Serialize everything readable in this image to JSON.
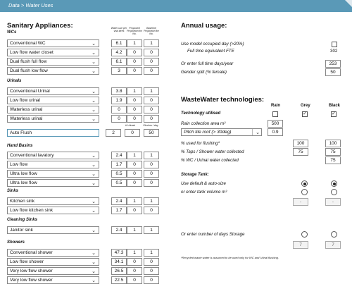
{
  "tab": {
    "label": "Data > Water Uses"
  },
  "left": {
    "title": "Sanitary Appliances:",
    "col_headers": [
      "Water use per visit litres",
      "Proposed Proportion for No.",
      "Baseline Proportion for No."
    ],
    "wcs": {
      "title": "WCs",
      "rows": [
        {
          "name": "Conventional WC",
          "use": "6.1",
          "prop": "1",
          "base": "1"
        },
        {
          "name": "Low flow water closet",
          "use": "4.2",
          "prop": "0",
          "base": "0"
        },
        {
          "name": "Dual flush full flow",
          "use": "6.1",
          "prop": "0",
          "base": "0"
        },
        {
          "name": "Dual flush low flow",
          "use": "3",
          "prop": "0",
          "base": "0"
        }
      ]
    },
    "urinals": {
      "title": "Urinals",
      "rows": [
        {
          "name": "Conventional Urinal",
          "use": "3.8",
          "prop": "1",
          "base": "1"
        },
        {
          "name": "Low flow urinal",
          "use": "1.9",
          "prop": "0",
          "base": "0"
        },
        {
          "name": "Waterless urinal",
          "use": "0",
          "prop": "0",
          "base": "0"
        },
        {
          "name": "Waterless urinal",
          "use": "0",
          "prop": "0",
          "base": "0"
        }
      ]
    },
    "autoflush": {
      "name": "Auto Flush",
      "h1": "# Urinals",
      "h2": "Flushes / day",
      "v1": "2",
      "v2": "0",
      "v3": "50"
    },
    "basins": {
      "title": "Hand Basins",
      "rows": [
        {
          "name": "Conventional lavatory",
          "use": "2.4",
          "prop": "1",
          "base": "1"
        },
        {
          "name": "Low flow",
          "use": "1.7",
          "prop": "0",
          "base": "0"
        },
        {
          "name": "Ultra low flow",
          "use": "0.5",
          "prop": "0",
          "base": "0"
        },
        {
          "name": "Ultra low flow",
          "use": "0.5",
          "prop": "0",
          "base": "0"
        }
      ]
    },
    "sinks": {
      "title": "Sinks",
      "rows": [
        {
          "name": "Kitchen sink",
          "use": "2.4",
          "prop": "1",
          "base": "1"
        },
        {
          "name": "Low flow kitchen sink",
          "use": "1.7",
          "prop": "0",
          "base": "0"
        }
      ]
    },
    "cleaning": {
      "title": "Cleaning Sinks",
      "rows": [
        {
          "name": "Janitor sink",
          "use": "2.4",
          "prop": "1",
          "base": "1"
        }
      ]
    },
    "showers": {
      "title": "Showers",
      "rows": [
        {
          "name": "Conventional shower",
          "use": "47.3",
          "prop": "1",
          "base": "1"
        },
        {
          "name": "Low flow shower",
          "use": "34.1",
          "prop": "0",
          "base": "0"
        },
        {
          "name": "Very low flow shower",
          "use": "26.5",
          "prop": "0",
          "base": "0"
        },
        {
          "name": "Very low flow shower",
          "use": "22.5",
          "prop": "0",
          "base": "0"
        }
      ]
    }
  },
  "annual": {
    "title": "Annual usage:",
    "occupied_label": "Use model occupied day (>20%)",
    "fte_label": "Full time equivalent FTE",
    "fte_value": "302",
    "days_label": "Or enter full time days/year",
    "days_value": "253",
    "gender_label": "Gender split (% female)",
    "gender_value": "50"
  },
  "waste": {
    "title": "WasteWater technologies:",
    "cols": [
      "Rain",
      "Grey",
      "Black"
    ],
    "tech_label": "Technology utilised",
    "area_label": "Rain collection area m²",
    "area_value": "500",
    "roof_value": "Pitch tile roof (> 30deg)",
    "roof_factor": "0.9",
    "flushing_label": "% used for flushing*",
    "flushing_rain": "100",
    "flushing_black": "100",
    "taps_label": "% Taps / Shower water collected",
    "taps_grey": "75",
    "taps_black": "75",
    "wc_label": "% WC / Urinal water collected",
    "wc_black": "75",
    "storage_title": "Storage Tank:",
    "default_label": "Use default & auto-size",
    "volume_label": "or enter tank volume m³",
    "dash": "-",
    "days_storage_label": "Or enter number of days Storage",
    "days_storage_value": "7",
    "note": "*Recycled waste water is assumed to be used only for WC and Urinal flushing."
  }
}
